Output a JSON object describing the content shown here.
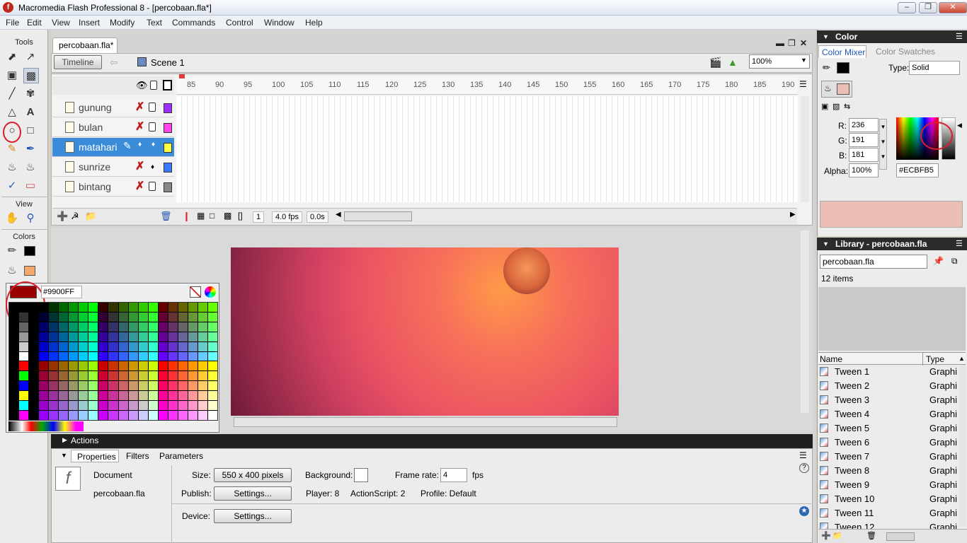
{
  "window": {
    "title": "Macromedia Flash Professional 8 - [percobaan.fla*]"
  },
  "menu": [
    "File",
    "Edit",
    "View",
    "Insert",
    "Modify",
    "Text",
    "Commands",
    "Control",
    "Window",
    "Help"
  ],
  "tools": {
    "header": "Tools",
    "view_header": "View",
    "colors_header": "Colors"
  },
  "document": {
    "tab": "percobaan.fla*",
    "timeline_button": "Timeline",
    "scene": "Scene 1",
    "zoom": "100%"
  },
  "timeline": {
    "ruler": [
      "85",
      "90",
      "95",
      "100",
      "105",
      "110",
      "115",
      "120",
      "125",
      "130",
      "135",
      "140",
      "145",
      "150",
      "155",
      "160",
      "165",
      "170",
      "175",
      "180",
      "185",
      "190"
    ],
    "layers": [
      {
        "name": "gunung",
        "color": "#9b30ff"
      },
      {
        "name": "bulan",
        "color": "#ff44ee"
      },
      {
        "name": "matahari",
        "color": "#ffff44"
      },
      {
        "name": "sunrize",
        "color": "#3a78ff"
      },
      {
        "name": "bintang",
        "color": "#888888"
      }
    ],
    "selected_layer": "matahari",
    "current_frame": "1",
    "fps": "4.0 fps",
    "time": "0.0s"
  },
  "palette": {
    "hex": "#9900FF",
    "selected_color": "#990000"
  },
  "actions": {
    "label": "Actions"
  },
  "properties": {
    "tabs": [
      "Properties",
      "Filters",
      "Parameters"
    ],
    "doc_type": "Document",
    "doc_name": "percobaan.fla",
    "size_label": "Size:",
    "size_value": "550 x 400 pixels",
    "background_label": "Background:",
    "framerate_label": "Frame rate:",
    "framerate_value": "4",
    "fps_unit": "fps",
    "publish_label": "Publish:",
    "settings_label": "Settings...",
    "player_text": "Player: 8",
    "actionscript_text": "ActionScript: 2",
    "profile_text": "Profile: Default",
    "device_label": "Device:"
  },
  "color_panel": {
    "title": "Color",
    "tabs": [
      "Color Mixer",
      "Color Swatches"
    ],
    "type_label": "Type:",
    "type_value": "Solid",
    "r_label": "R:",
    "r": "236",
    "g_label": "G:",
    "g": "191",
    "b_label": "B:",
    "b": "181",
    "alpha_label": "Alpha:",
    "alpha": "100%",
    "hex": "#ECBFB5",
    "preview_color": "#ecbfb5"
  },
  "library": {
    "title": "Library - percobaan.fla",
    "doc": "percobaan.fla",
    "count": "12 items",
    "col_name": "Name",
    "col_type": "Type",
    "items": [
      {
        "name": "Tween 1",
        "type": "Graphi"
      },
      {
        "name": "Tween 2",
        "type": "Graphi"
      },
      {
        "name": "Tween 3",
        "type": "Graphi"
      },
      {
        "name": "Tween 4",
        "type": "Graphi"
      },
      {
        "name": "Tween 5",
        "type": "Graphi"
      },
      {
        "name": "Tween 6",
        "type": "Graphi"
      },
      {
        "name": "Tween 7",
        "type": "Graphi"
      },
      {
        "name": "Tween 8",
        "type": "Graphi"
      },
      {
        "name": "Tween 9",
        "type": "Graphi"
      },
      {
        "name": "Tween 10",
        "type": "Graphi"
      },
      {
        "name": "Tween 11",
        "type": "Graphi"
      },
      {
        "name": "Tween 12",
        "type": "Graphi"
      }
    ]
  }
}
